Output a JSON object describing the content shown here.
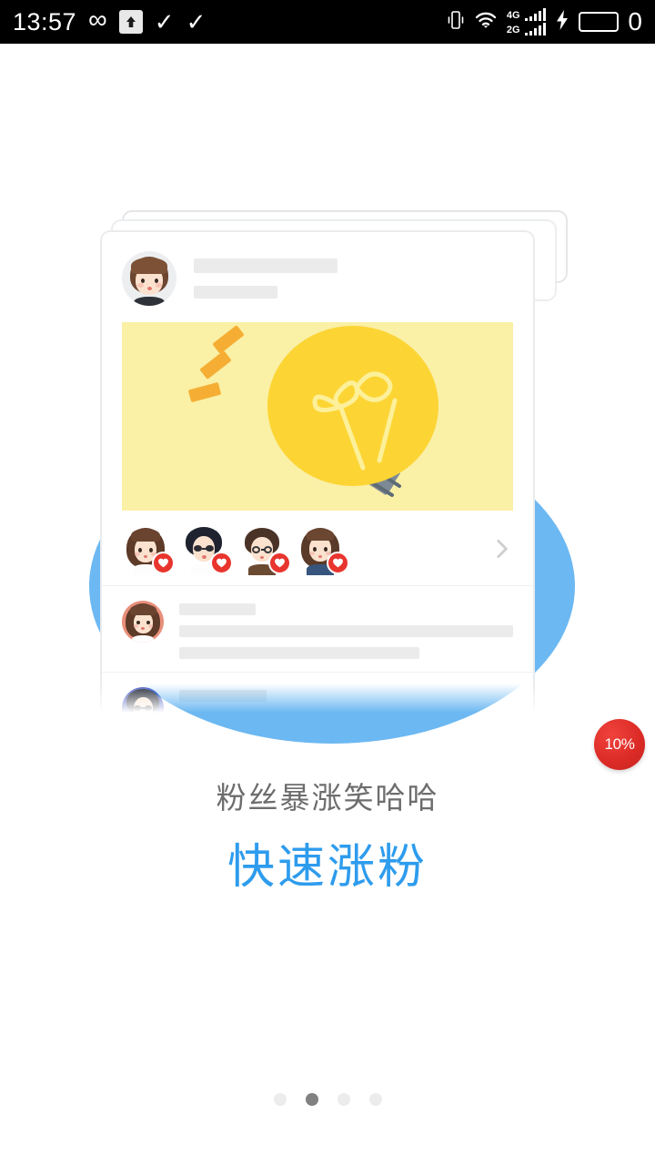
{
  "status_bar": {
    "time": "13:57",
    "zero_glyph": "0",
    "icons_left": [
      "infinity-icon",
      "upload-icon",
      "check-circle-icon",
      "check-circle-icon"
    ],
    "icons_right": [
      "vibrate-icon",
      "wifi-icon",
      "signal-4g-icon",
      "signal-2g-icon",
      "charging-bolt-icon",
      "battery-icon"
    ],
    "signal": [
      {
        "label": "4G",
        "bars": 5
      },
      {
        "label": "2G",
        "bars": 5
      }
    ]
  },
  "card": {
    "header": {
      "avatar": "user-avatar-boy",
      "placeholder_name": "",
      "placeholder_meta": ""
    },
    "banner": {
      "illustration": "lightbulb-idea-illustration",
      "bg_color": "#faf0a6",
      "bulb_color": "#fcd535",
      "base_color": "#7d8a95",
      "ray_color": "#f5ae33"
    },
    "likers": [
      {
        "name": "liker-avatar-1",
        "bg": "#e98f7a",
        "badge": "heart-icon"
      },
      {
        "name": "liker-avatar-2",
        "bg": "#4a5bc0",
        "badge": "heart-icon"
      },
      {
        "name": "liker-avatar-3",
        "bg": "#5e9c85",
        "badge": "heart-icon"
      },
      {
        "name": "liker-avatar-4",
        "bg": "#f2cf5b",
        "badge": "heart-icon"
      }
    ],
    "liker_more_icon": "chevron-right-icon",
    "comments": [
      {
        "avatar": "commenter-avatar-1",
        "bg": "#e98f7a",
        "lines": 3
      },
      {
        "avatar": "commenter-avatar-2",
        "bg": "#4a5bc0",
        "lines": 2
      }
    ]
  },
  "badge": {
    "label": "10%",
    "color": "#dc2b26"
  },
  "caption": {
    "subtitle": "粉丝暴涨笑哈哈",
    "title": "快速涨粉",
    "title_color": "#2e9ced",
    "subtitle_color": "#6d6d6d"
  },
  "pager": {
    "total": 4,
    "active_index": 1
  },
  "theme": {
    "background": "#ffffff",
    "accent_blue": "#6cb8f2",
    "placeholder_grey": "#ebebeb"
  }
}
